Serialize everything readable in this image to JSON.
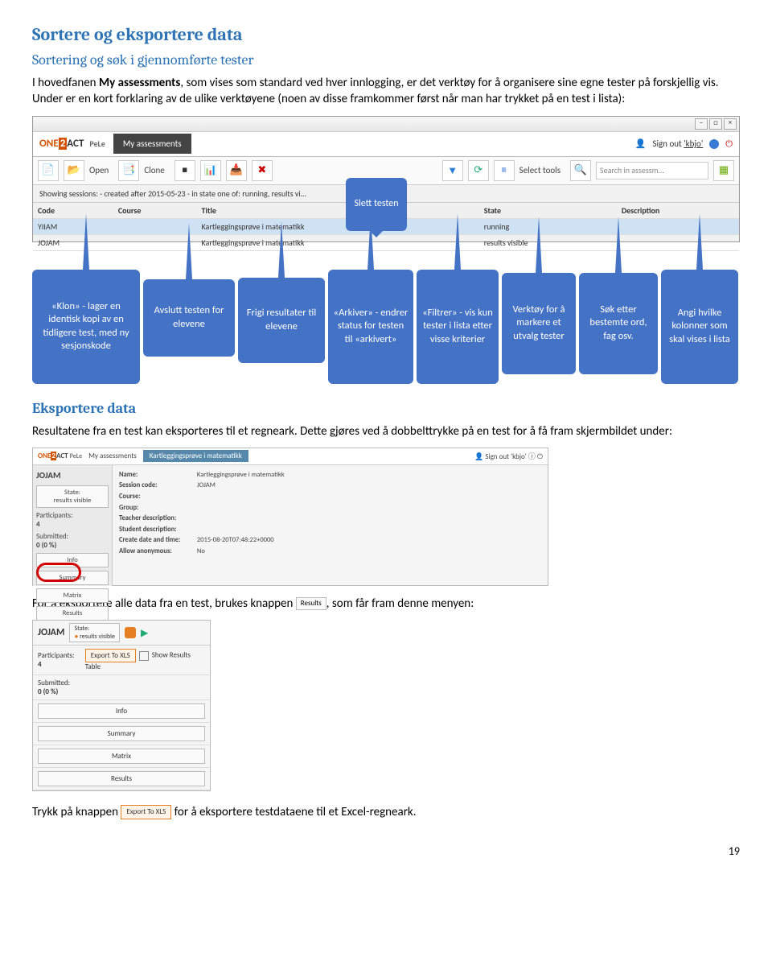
{
  "h1": "Sortere og eksportere data",
  "h2a": "Sortering og søk i gjennomførte tester",
  "intro_pre": "I hovedfanen ",
  "intro_bold": "My assessments",
  "intro_post": ", som vises som standard ved hver innlogging, er det verktøy for å organisere sine egne tester på forskjellig vis. Under er en kort forklaring av de ulike verktøyene (noen av disse framkommer først når man har trykket på en test i lista):",
  "scr1": {
    "brand": "ONE2ACT",
    "pele": "PeLe",
    "tab": "My assessments",
    "signout": "Sign out",
    "user": "'kbjo'",
    "toolbar": {
      "open": "Open",
      "clone": "Clone",
      "select_tools": "Select tools",
      "search_placeholder": "Search in assessm…"
    },
    "showing": "Showing sessions: - created after 2015-05-23 - in state one of: running, results vi…",
    "headers": {
      "code": "Code",
      "course": "Course",
      "title": "Title",
      "state": "State",
      "desc": "Description"
    },
    "rows": [
      {
        "code": "YIIAM",
        "course": "",
        "title": "Kartleggingsprøve i matematikk",
        "state": "running",
        "desc": ""
      },
      {
        "code": "JOJAM",
        "course": "",
        "title": "Kartleggingsprøve i matematikk",
        "state": "results visible",
        "desc": ""
      }
    ]
  },
  "callouts": {
    "slett": "Slett testen",
    "klon": "«Klon» - lager en identisk kopi av en tidligere test, med ny sesjonskode",
    "avslutt": "Avslutt testen for elevene",
    "frigi": "Frigi resultater til elevene",
    "arkiver": "«Arkiver» - endrer status for testen til «arkivert»",
    "filtrer": "«Filtrer» - vis kun tester i lista etter visse kriterier",
    "verktoy": "Verktøy for å markere et utvalg tester",
    "sok": "Søk etter bestemte ord, fag osv.",
    "angi": "Angi hvilke kolonner som skal vises i lista"
  },
  "h2b": "Eksportere data",
  "export_para": "Resultatene fra en test kan eksporteres til et regneark. Dette gjøres ved å dobbelttrykke på en test for å få fram skjermbildet under:",
  "scr2": {
    "brand": "ONE2ACT PeLe",
    "tab1": "My assessments",
    "tab2": "Kartleggingsprøve i matematikk",
    "signout": "Sign out 'kbjo'",
    "code": "JOJAM",
    "state_label": "State:",
    "state": "results visible",
    "participants_label": "Participants:",
    "participants": "4",
    "submitted_label": "Submitted:",
    "submitted": "0 (0 %)",
    "side": [
      "Info",
      "Summary",
      "Matrix",
      "Results"
    ],
    "fields": {
      "Name:": "Kartleggingsprøve i matematikk",
      "Session code:": "JOJAM",
      "Course:": "",
      "Group:": "",
      "Teacher description:": "",
      "Student description:": "",
      "Create date and time:": "2015-08-20T07:48:22+0000",
      "Allow anonymous:": "No"
    }
  },
  "line2_pre": "For å eksportere alle data fra en test, brukes knappen ",
  "line2_btn": "Results",
  "line2_post": ", som får fram denne menyen:",
  "scr3": {
    "code": "JOJAM",
    "state_label": "State:",
    "state": "results visible",
    "participants_label": "Participants:",
    "participants": "4",
    "export_btn": "Export To XLS",
    "show_table": "Show Results Table",
    "submitted_label": "Submitted:",
    "submitted": "0 (0 %)",
    "tabs": [
      "Info",
      "Summary",
      "Matrix",
      "Results"
    ]
  },
  "line3_pre": "Trykk på knappen ",
  "line3_btn": "Export To XLS",
  "line3_post": " for å eksportere testdataene til et Excel-regneark.",
  "pagenum": "19"
}
